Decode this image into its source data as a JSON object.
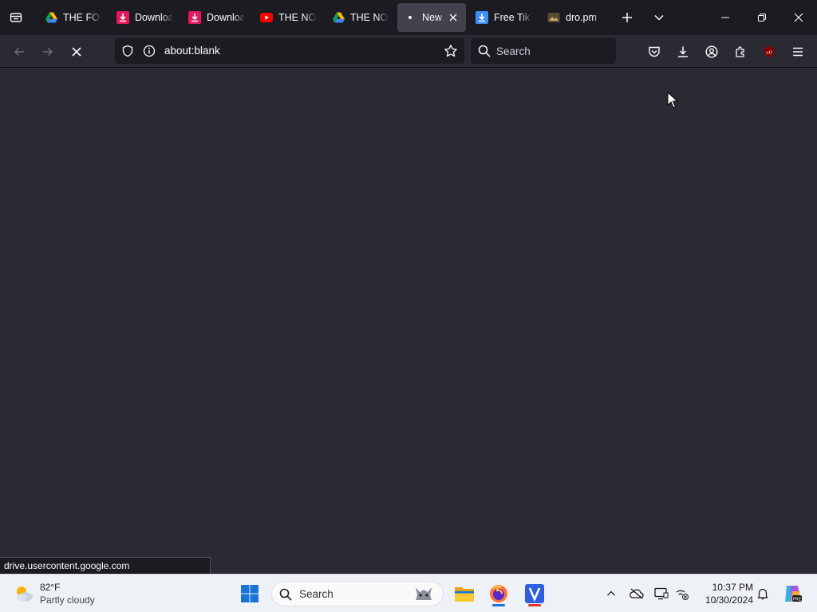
{
  "tabs": [
    {
      "label": "THE FORMULA",
      "icon": "google-drive-icon"
    },
    {
      "label": "Download",
      "icon": "download-site-icon"
    },
    {
      "label": "Download",
      "icon": "download-site-icon"
    },
    {
      "label": "THE NORTH",
      "icon": "youtube-icon"
    },
    {
      "label": "THE NORTH",
      "icon": "google-drive-icon"
    },
    {
      "label": "New Tab",
      "icon": "loading-dot-icon"
    },
    {
      "label": "Free TikTok",
      "icon": "download-arrow-icon"
    },
    {
      "label": "dro.pm",
      "icon": "folder-image-icon"
    }
  ],
  "navbar": {
    "url": "about:blank",
    "search_placeholder": "Search"
  },
  "status": {
    "text": "drive.usercontent.google.com"
  },
  "taskbar": {
    "weather_temp": "82°F",
    "weather_condition": "Partly cloudy",
    "search_placeholder": "Search",
    "time": "10:37 PM",
    "date": "10/30/2024"
  },
  "colors": {
    "tabbar_bg": "#1c1b22",
    "content_bg": "#2b2a33",
    "active_tab": "#42414d",
    "taskbar_bg": "#eef1f6"
  }
}
